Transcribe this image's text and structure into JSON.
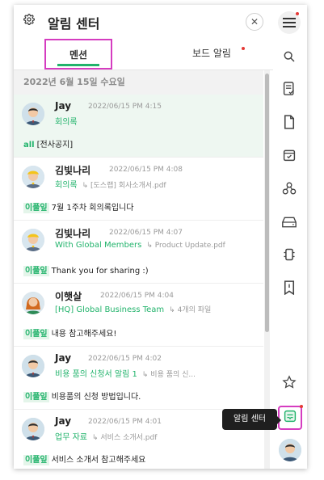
{
  "header": {
    "title": "알림 센터",
    "close_symbol": "✕"
  },
  "tabs": [
    {
      "label": "멘션",
      "active": true
    },
    {
      "label": "보드 알림",
      "has_dot": true
    }
  ],
  "date_group": "2022년 6월 15일 수요일",
  "items": [
    {
      "name": "Jay",
      "time": "2022/06/15 PM 4:15",
      "channel": "회의록",
      "file": "",
      "tag": "all",
      "tag_style": "plain",
      "text": "[전사공지]",
      "highlighted": true,
      "avatar": "male"
    },
    {
      "name": "김빛나리",
      "time": "2022/06/15 PM 4:08",
      "channel": "회의록",
      "file": "[도스랩] 회사소개서.pdf",
      "tag": "이풀잎",
      "tag_style": "chip",
      "text": "7월 1주차 회의록입니다",
      "avatar": "kid"
    },
    {
      "name": "김빛나리",
      "time": "2022/06/15 PM 4:07",
      "channel": "With Global Members",
      "file": "Product Update.pdf",
      "tag": "이풀잎",
      "tag_style": "chip",
      "text": "Thank you for sharing :)",
      "avatar": "kid"
    },
    {
      "name": "이햇살",
      "time": "2022/06/15 PM 4:04",
      "channel": "[HQ] Global Business Team",
      "file": "4개의 파일",
      "tag": "이풀잎",
      "tag_style": "chip",
      "text": "내용 참고해주세요!",
      "avatar": "female"
    },
    {
      "name": "Jay",
      "time": "2022/06/15 PM 4:02",
      "channel": "비용 품의 신청서 알림 1",
      "file": "비용 품의 신...",
      "tag": "이풀잎",
      "tag_style": "chip",
      "text": "비용품의 신청 방법입니다.",
      "avatar": "male"
    },
    {
      "name": "Jay",
      "time": "2022/06/15 PM 4:01",
      "channel": "업무 자료",
      "file": "서비스 소개서.pdf",
      "tag": "이풀잎",
      "tag_style": "chip",
      "text": "서비스 소개서 참고해주세요",
      "avatar": "male"
    }
  ],
  "sidebar": {
    "icons": [
      "menu-icon",
      "search-icon",
      "notes-icon",
      "document-icon",
      "calendar-check-icon",
      "org-chart-icon",
      "drive-icon",
      "chip-icon",
      "bookmark-icon",
      "star-icon",
      "alarm-center-icon"
    ],
    "tooltip": "알림 센터"
  },
  "colors": {
    "accent": "#21b36b",
    "highlight_border": "#d53cc0",
    "red_dot": "#e53935"
  }
}
